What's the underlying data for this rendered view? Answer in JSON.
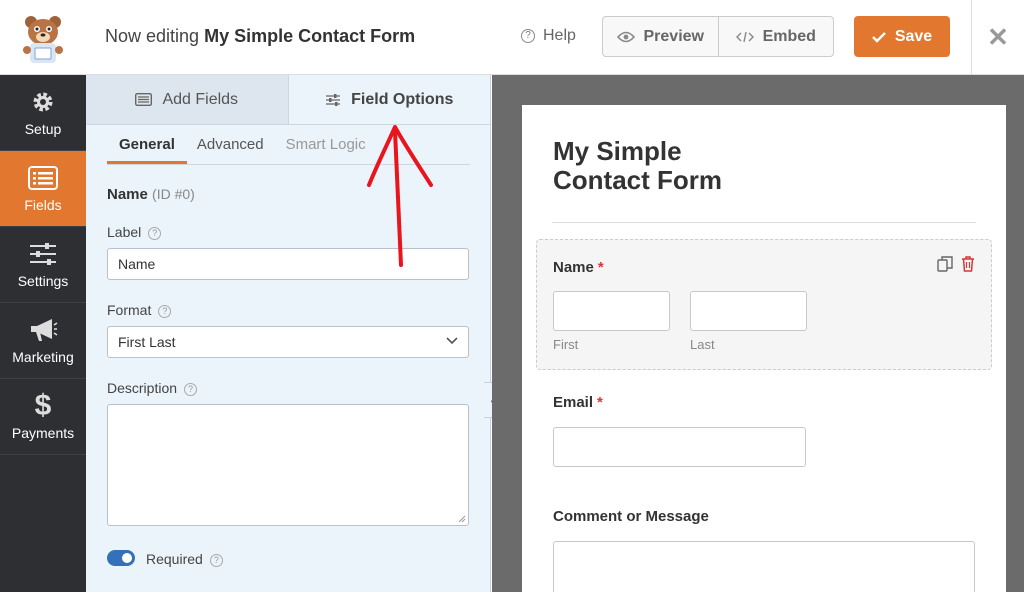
{
  "header": {
    "title_prefix": "Now editing",
    "title_form": "My Simple Contact Form",
    "help_label": "Help",
    "preview_label": "Preview",
    "embed_label": "Embed",
    "save_label": "Save"
  },
  "nav": [
    {
      "label": "Setup",
      "icon": "gear-icon"
    },
    {
      "label": "Fields",
      "icon": "fields-icon"
    },
    {
      "label": "Settings",
      "icon": "sliders-icon"
    },
    {
      "label": "Marketing",
      "icon": "megaphone-icon"
    },
    {
      "label": "Payments",
      "icon": "dollar-icon"
    }
  ],
  "panel": {
    "tabs": [
      "Add Fields",
      "Field Options"
    ],
    "subtabs": [
      "General",
      "Advanced",
      "Smart Logic"
    ],
    "field_name": "Name",
    "field_id": "(ID #0)",
    "label_label": "Label",
    "label_value": "Name",
    "format_label": "Format",
    "format_value": "First Last",
    "description_label": "Description",
    "required_label": "Required",
    "required_on": true
  },
  "preview": {
    "form_title_1": "My Simple",
    "form_title_2": "Contact Form",
    "name_label": "Name",
    "first_label": "First",
    "last_label": "Last",
    "email_label": "Email",
    "comment_label": "Comment or Message",
    "required_mark": "*"
  },
  "colors": {
    "accent": "#e27730",
    "nav_bg": "#2d2f33",
    "panel_bg": "#ebf3fb",
    "toggle": "#3372b8",
    "annotation_arrow": "#e8141e"
  }
}
